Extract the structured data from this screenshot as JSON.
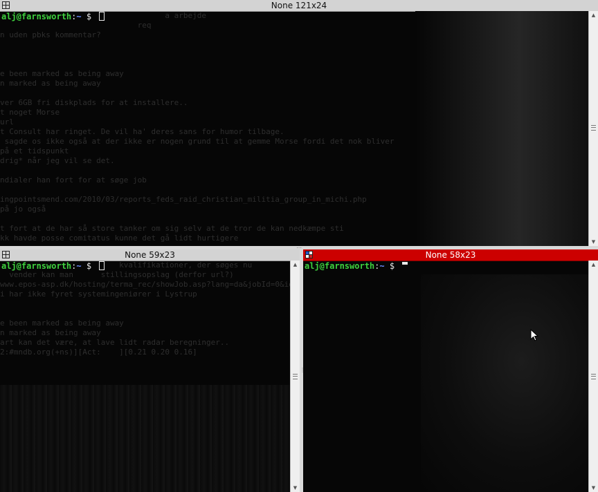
{
  "panes": {
    "top": {
      "title": "None 121x24",
      "active": false,
      "prompt": {
        "user_host": "alj@farnsworth",
        "sep": ":",
        "dir": "~",
        "sign": " $ "
      },
      "background_lines": [
        "                                    a arbejde",
        "                              req",
        "n uden pbks kommentar?",
        "",
        "",
        "",
        "e been marked as being away",
        "n marked as being away",
        "",
        "ver 6GB fri diskplads for at installere..",
        "t noget Morse",
        "url",
        "t Consult har ringet. De vil ha' deres sans for humor tilbage.",
        " sagde os ikke også at der ikke er nogen grund til at gemme Morse fordi det nok bliver",
        "på et tidspunkt",
        "drig* når jeg vil se det.",
        "",
        "ndialer han fort for at søge job",
        "",
        "ingpointsmend.com/2010/03/reports_feds_raid_christian_militia_group_in_michi.php",
        "på jo også",
        "",
        "t fort at de har så store tanker om sig selv at de tror de kan nedkæmpe sti",
        "kk havde posse comitatus kunne det gå lidt hurtigere"
      ]
    },
    "bottom_left": {
      "title": "None 59x23",
      "active": false,
      "prompt": {
        "user_host": "alj@farnsworth",
        "sep": ":",
        "dir": "~",
        "sign": " $ "
      },
      "background_lines": [
        "                          kvalifikationer, der søges nu",
        "  vender kan man      stillingsopslag (derfor url?)",
        "www.epos-asp.dk/hosting/terma_rec/showJob.asp?lang=da&jobId=0&id=399",
        "i har ikke fyret systemingeniører i Lystrup",
        "",
        "",
        "e been marked as being away",
        "n marked as being away",
        "art kan det være, at lave lidt radar beregninger..",
        "2:#mndb.org(+ns)][Act:    ][0.21 0.20 0.16]"
      ]
    },
    "bottom_right": {
      "title": "None 58x23",
      "active": true,
      "prompt": {
        "user_host": "alj@farnsworth",
        "sep": ":",
        "dir": "~",
        "sign": " $ "
      }
    }
  },
  "icons": {
    "window_menu": "window-menu-icon",
    "scroll_up": "scroll-up-arrow-icon",
    "scroll_down": "scroll-down-arrow-icon",
    "mouse_pointer": "mouse-pointer-icon"
  },
  "colors": {
    "active_titlebar": "#cc0000",
    "inactive_titlebar": "#d3d3d3",
    "prompt_user": "#3ed13e",
    "prompt_dir": "#6b8cff"
  }
}
